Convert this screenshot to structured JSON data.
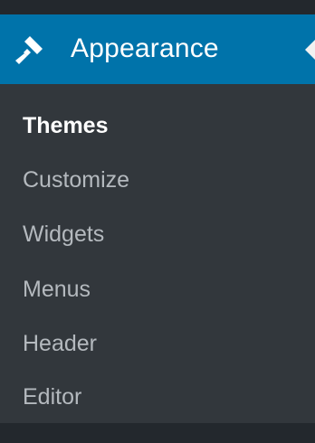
{
  "menu": {
    "active_label": "Appearance",
    "active_icon": "paintbrush-icon",
    "submenu": [
      {
        "label": "Themes",
        "current": true
      },
      {
        "label": "Customize",
        "current": false
      },
      {
        "label": "Widgets",
        "current": false
      },
      {
        "label": "Menus",
        "current": false
      },
      {
        "label": "Header",
        "current": false
      },
      {
        "label": "Editor",
        "current": false
      }
    ]
  },
  "colors": {
    "sidebar_bg": "#23282d",
    "submenu_bg": "#32373c",
    "active_bg": "#0073aa",
    "text_active": "#ffffff",
    "text_muted": "#b4b9be"
  }
}
